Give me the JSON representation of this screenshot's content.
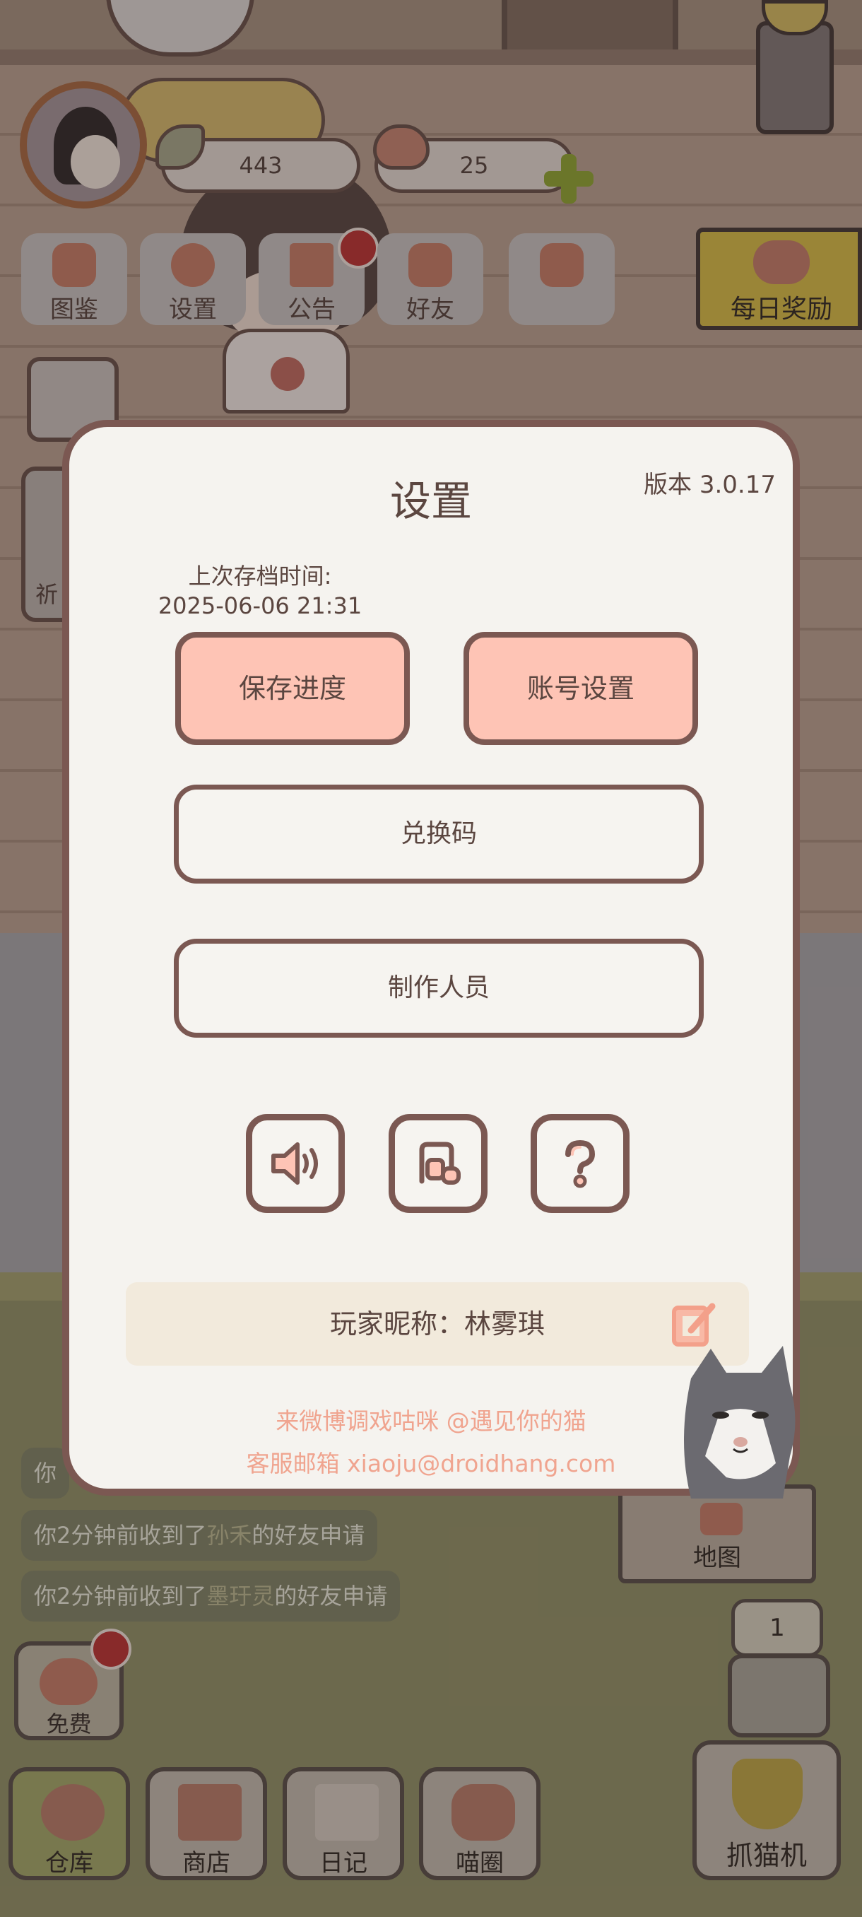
{
  "hud": {
    "fish_count": "443",
    "heart_count": "25"
  },
  "top_menu": [
    {
      "label": "图鉴"
    },
    {
      "label": "设置"
    },
    {
      "label": "公告"
    },
    {
      "label": "好友"
    },
    {
      "label": ""
    }
  ],
  "daily_reward": {
    "label": "每日奖励"
  },
  "left_side": {
    "partial_label": "祈"
  },
  "dialog": {
    "title": "设置",
    "version": "版本 3.0.17",
    "save_time_label": "上次存档时间:",
    "save_time_value": "2025-06-06 21:31",
    "save_button": "保存进度",
    "account_button": "账号设置",
    "redeem_button": "兑换码",
    "credits_button": "制作人员",
    "nickname_label": "玩家昵称：林雾琪",
    "weibo_text": "来微博调戏咕咪 @遇见你的猫",
    "email_text": "客服邮箱 xiaoju@droidhang.com"
  },
  "chat": [
    {
      "prefix": "你",
      "name": "",
      "suffix": ""
    },
    {
      "prefix": "你2分钟前收到了",
      "name": "孙禾",
      "suffix": "的好友申请"
    },
    {
      "prefix": "你2分钟前收到了",
      "name": "墨玗灵",
      "suffix": "的好友申请"
    }
  ],
  "map": {
    "label": "地图"
  },
  "floor": {
    "value": "1"
  },
  "free": {
    "label": "免费"
  },
  "bottom_nav": [
    {
      "label": "仓库"
    },
    {
      "label": "商店"
    },
    {
      "label": "日记"
    },
    {
      "label": "喵圈"
    }
  ],
  "claw": {
    "label": "抓猫机"
  },
  "colors": {
    "dialog_bg": "#f5f3ef",
    "dialog_border": "#7b5852",
    "pink_button": "#fec4b5",
    "link_text": "#f0a48f",
    "nickname_bg": "#f2eadc"
  },
  "icons": [
    "fish-icon",
    "heart-icon",
    "plus-icon",
    "speaker-icon",
    "music-icon",
    "help-icon",
    "edit-icon",
    "cat-icon",
    "gear-icon",
    "gift-icon",
    "friends-icon"
  ]
}
